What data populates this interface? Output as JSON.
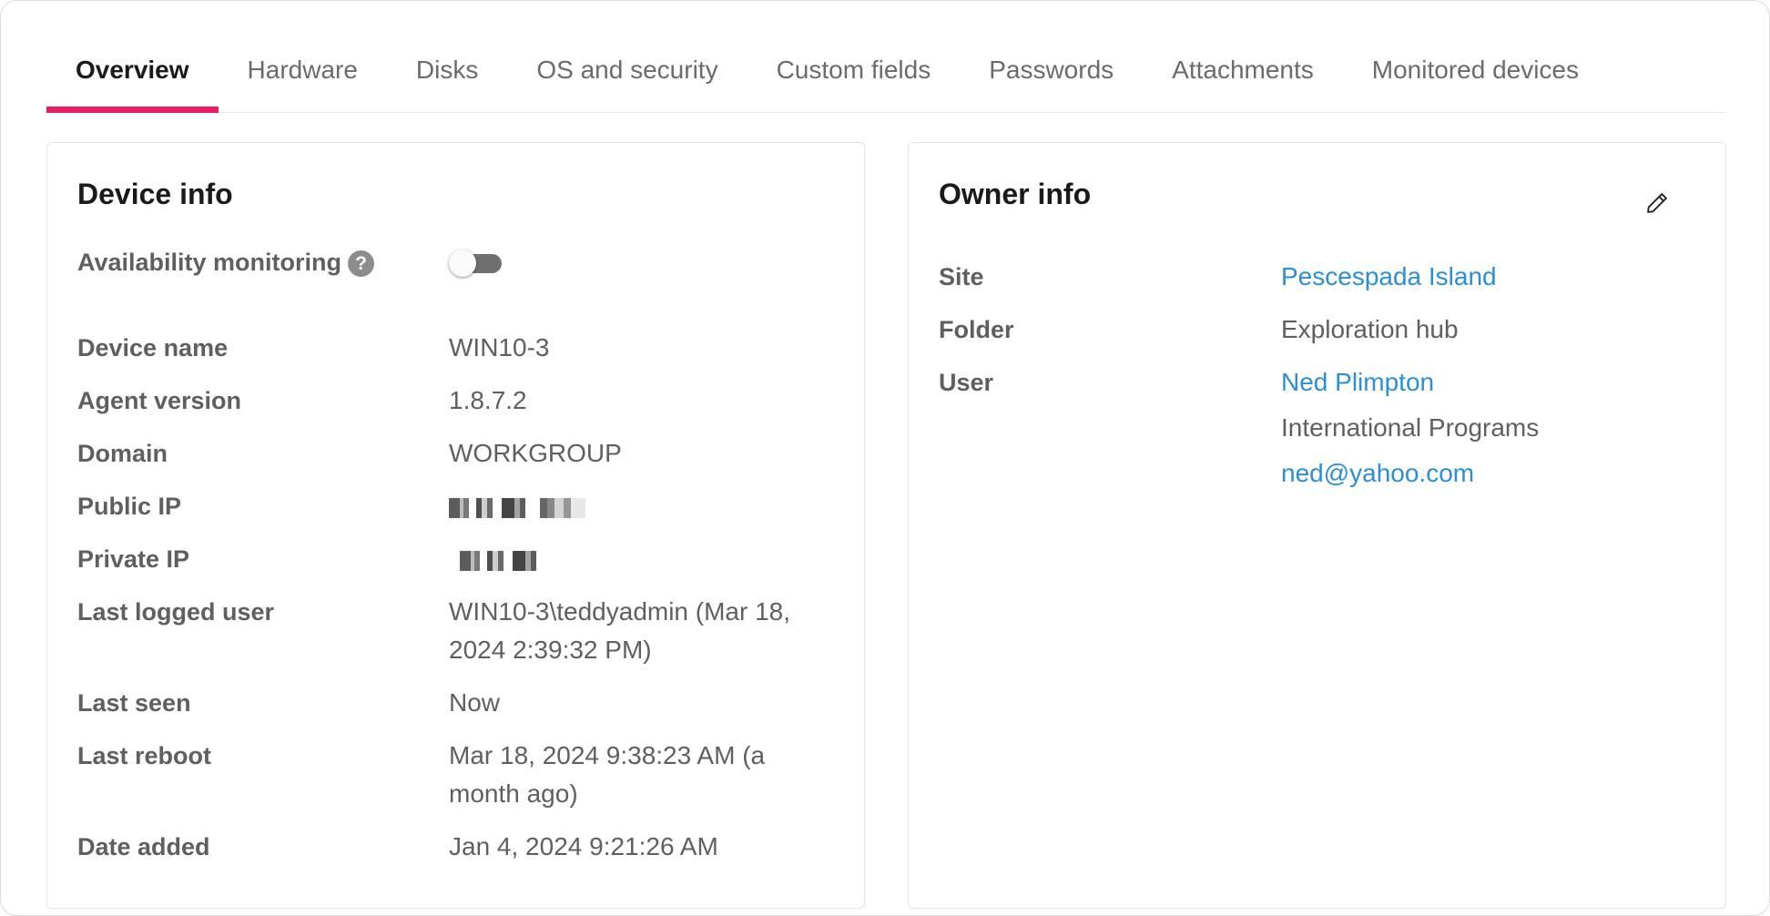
{
  "tabs": [
    {
      "label": "Overview",
      "active": true
    },
    {
      "label": "Hardware"
    },
    {
      "label": "Disks"
    },
    {
      "label": "OS and security"
    },
    {
      "label": "Custom fields"
    },
    {
      "label": "Passwords"
    },
    {
      "label": "Attachments"
    },
    {
      "label": "Monitored devices"
    }
  ],
  "accent_color": "#e91e63",
  "link_color": "#2a8fd6",
  "device_info": {
    "title": "Device info",
    "availability_label": "Availability monitoring",
    "help_glyph": "?",
    "availability_enabled": false,
    "rows": [
      {
        "label": "Device name",
        "value": "WIN10-3"
      },
      {
        "label": "Agent version",
        "value": "1.8.7.2"
      },
      {
        "label": "Domain",
        "value": "WORKGROUP"
      },
      {
        "label": "Public IP",
        "value": ""
      },
      {
        "label": "Private IP",
        "value": ""
      },
      {
        "label": "Last logged user",
        "value": "WIN10-3\\teddyadmin (Mar 18, 2024 2:39:32 PM)"
      },
      {
        "label": "Last seen",
        "value": "Now"
      },
      {
        "label": "Last reboot",
        "value": "Mar 18, 2024 9:38:23 AM (a month ago)"
      },
      {
        "label": "Date added",
        "value": "Jan 4, 2024 9:21:26 AM"
      }
    ]
  },
  "owner_info": {
    "title": "Owner info",
    "edit_icon": "pencil-icon",
    "site_label": "Site",
    "site_value": "Pescespada Island",
    "folder_label": "Folder",
    "folder_value": "Exploration hub",
    "user_label": "User",
    "user_name": "Ned Plimpton",
    "user_department": "International Programs",
    "user_email": "ned@yahoo.com"
  }
}
